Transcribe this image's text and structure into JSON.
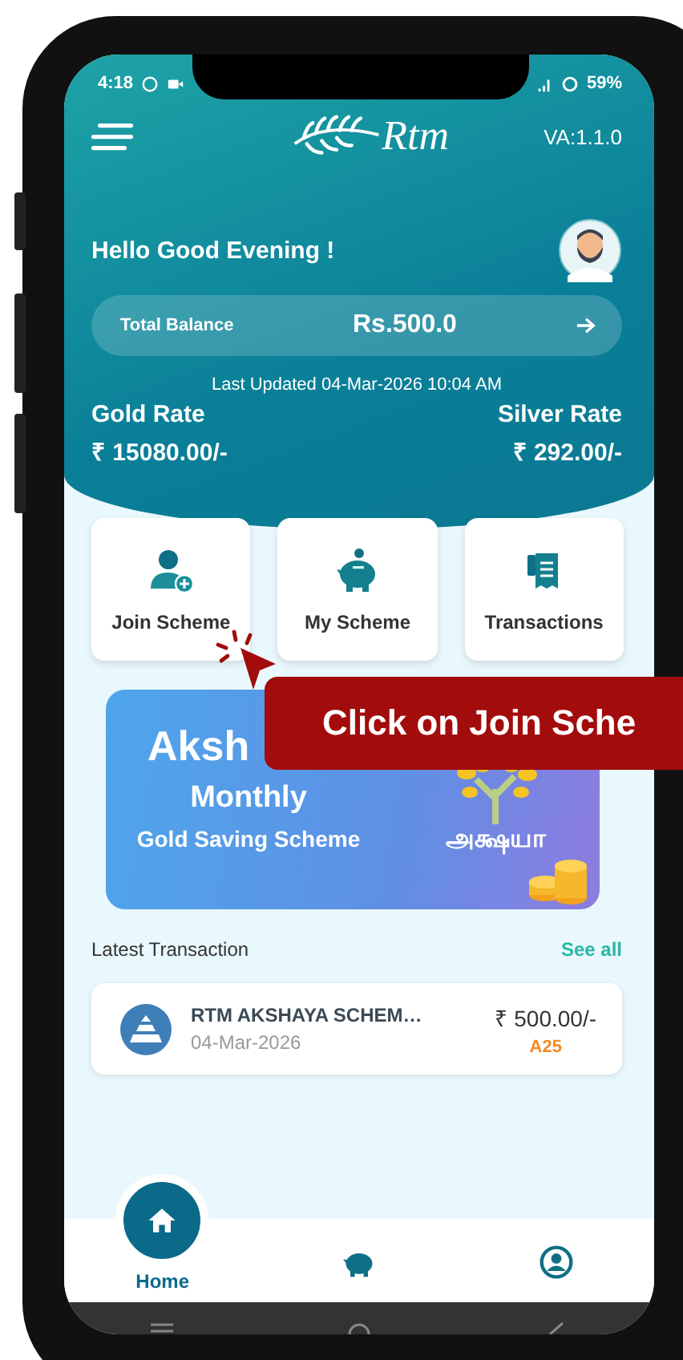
{
  "status_bar": {
    "time": "4:18",
    "battery": "59%"
  },
  "header": {
    "logo": "Rtm",
    "version": "VA:1.1.0",
    "greeting": "Hello Good Evening !"
  },
  "balance": {
    "label": "Total Balance",
    "amount": "Rs.500.0"
  },
  "last_updated": "Last Updated 04-Mar-2026 10:04 AM",
  "rates": [
    {
      "label": "Gold Rate",
      "value": "₹ 15080.00/-"
    },
    {
      "label": "Silver Rate",
      "value": "₹ 292.00/-"
    }
  ],
  "actions": [
    {
      "label": "Join Scheme",
      "kind": "join"
    },
    {
      "label": "My Scheme",
      "kind": "piggy"
    },
    {
      "label": "Transactions",
      "kind": "receipt"
    }
  ],
  "banner": {
    "title": "Aksh",
    "subtitle": "Monthly",
    "caption": "Gold Saving Scheme",
    "tamil": "அக்ஷயா"
  },
  "latest": {
    "title": "Latest Transaction",
    "link": "See all",
    "items": [
      {
        "name": "RTM AKSHAYA SCHEM…",
        "date": "04-Mar-2026",
        "amount": "₹ 500.00/-",
        "code": "A25"
      }
    ]
  },
  "nav": [
    {
      "kind": "home",
      "label": "Home",
      "selected": true
    },
    {
      "kind": "piggy",
      "selected": false
    },
    {
      "kind": "profile",
      "selected": false
    }
  ],
  "callout": "Click on Join Sche"
}
